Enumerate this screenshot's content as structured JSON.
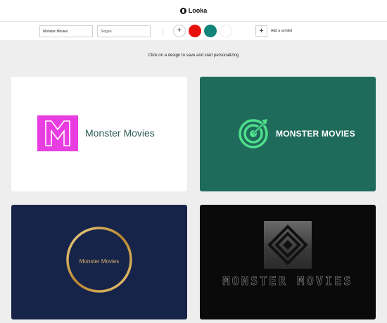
{
  "app": {
    "title": "Looka"
  },
  "toolbar": {
    "company_name_value": "Monster Movies",
    "slogan_placeholder": "Slogan",
    "add_color_label": "+",
    "colors": [
      "#e8100c",
      "#138479",
      "#ffffff"
    ],
    "add_symbol_button_label": "+",
    "add_symbol_label": "Add a symbol"
  },
  "main": {
    "prompt": "Click on a design to save and start personalizing",
    "designs": [
      {
        "name": "Monster Movies",
        "monogram": "M",
        "background": "#ffffff",
        "accent": "#e83de0",
        "icon": "letter-m-icon"
      },
      {
        "name": "MONSTER MOVIES",
        "background": "#1f6b5b",
        "accent": "#4fe08a",
        "icon": "target-arrow-icon"
      },
      {
        "name": "Monster Movies",
        "background": "#17244a",
        "accent": "#c9a24f",
        "icon": "gold-ring-icon"
      },
      {
        "name": "MONSTER MOVIES",
        "background": "#0a0a0a",
        "accent": "#8a8a8a",
        "icon": "diamond-emblem-icon"
      }
    ]
  }
}
